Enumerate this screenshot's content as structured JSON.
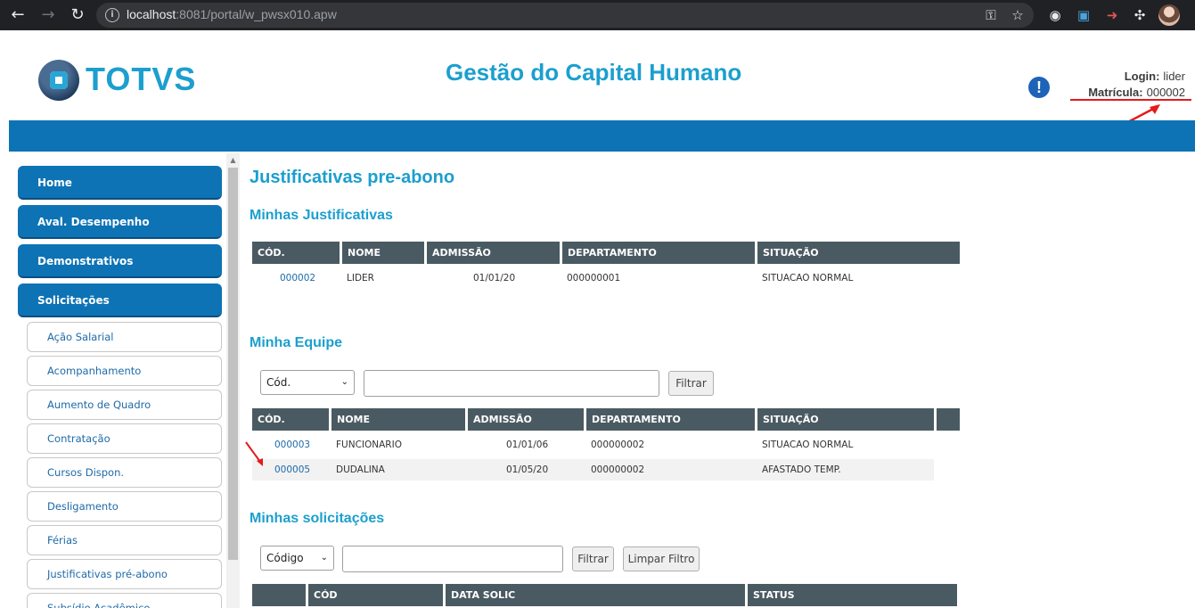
{
  "browser": {
    "url_host": "localhost",
    "url_path": ":8081/portal/w_pwsx010.apw"
  },
  "header": {
    "logo_text": "TOTVS",
    "app_title": "Gestão do Capital Humano",
    "login_label": "Login:",
    "login_value": "lider",
    "matricula_label": "Matrícula:",
    "matricula_value": "000002"
  },
  "sidebar": {
    "main_items": [
      "Home",
      "Aval. Desempenho",
      "Demonstrativos",
      "Solicitações"
    ],
    "sub_items": [
      "Ação Salarial",
      "Acompanhamento",
      "Aumento de Quadro",
      "Contratação",
      "Cursos Dispon.",
      "Desligamento",
      "Férias",
      "Justificativas pré-abono",
      "Subsídio Acadêmico"
    ]
  },
  "main": {
    "page_title": "Justificativas pre-abono",
    "minhas": {
      "title": "Minhas Justificativas",
      "headers": [
        "CÓD.",
        "NOME",
        "ADMISSÃO",
        "DEPARTAMENTO",
        "SITUAÇÃO"
      ],
      "rows": [
        [
          "000002",
          "LIDER",
          "01/01/20",
          "000000001",
          "SITUACAO NORMAL"
        ]
      ]
    },
    "equipe": {
      "title": "Minha Equipe",
      "select_value": "Cód.",
      "filter_button": "Filtrar",
      "headers": [
        "CÓD.",
        "NOME",
        "ADMISSÃO",
        "DEPARTAMENTO",
        "SITUAÇÃO"
      ],
      "rows": [
        [
          "000003",
          "FUNCIONARIO",
          "01/01/06",
          "000000002",
          "SITUACAO NORMAL"
        ],
        [
          "000005",
          "DUDALINA",
          "01/05/20",
          "000000002",
          "AFASTADO TEMP."
        ]
      ]
    },
    "solicitacoes": {
      "title": "Minhas solicitações",
      "select_value": "Código",
      "filter_button": "Filtrar",
      "clear_button": "Limpar Filtro",
      "headers": [
        "",
        "CÓD",
        "DATA SOLIC",
        "STATUS"
      ]
    }
  },
  "colors": {
    "brand_blue": "#0d73b5",
    "title_cyan": "#1c9fce",
    "table_header": "#4a5a62",
    "annotation_red": "#e41a1a"
  }
}
